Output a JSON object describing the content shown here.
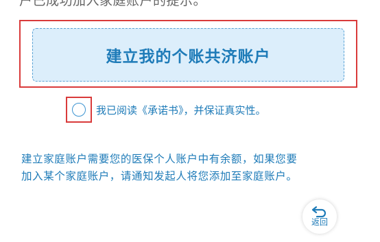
{
  "top_partial_text": "户已成功加入家庭账户的提示。",
  "create_button": {
    "label": "建立我的个账共济账户"
  },
  "agreement": {
    "text": "我已阅读《承诺书》，并保证真实性。"
  },
  "notice": {
    "line1": "建立家庭账户需要您的医保个人账户中有余额，如果您要",
    "line2": "加入某个家庭账户，请通知发起人将您添加至家庭账户。"
  },
  "back_button": {
    "label": "返回",
    "icon": "return-arrow-icon"
  },
  "colors": {
    "accent": "#1e7bb8",
    "button_bg": "#dceefb",
    "highlight": "#d93a3a"
  }
}
